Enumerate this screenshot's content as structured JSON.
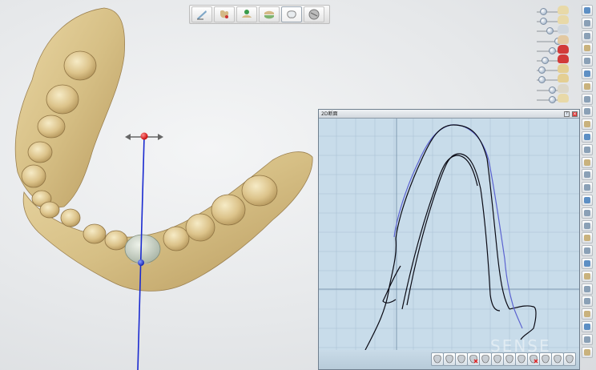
{
  "top_toolbar": {
    "tools": [
      {
        "icon": "scalpel-icon"
      },
      {
        "icon": "tooth-tools-icon"
      },
      {
        "icon": "jaw-upload-icon"
      },
      {
        "icon": "bite-alignment-icon"
      },
      {
        "icon": "crown-icon",
        "active": true
      },
      {
        "icon": "texture-sphere-icon"
      }
    ]
  },
  "right_panel": {
    "opacity_sliders": [
      {
        "swatch_color": "#e8d9a8",
        "level": 0.2
      },
      {
        "swatch_color": "#e8d9a8",
        "level": 0.2
      },
      {
        "swatch_color": "#cfd6dd",
        "level": 0.5
      },
      {
        "swatch_color": "#e3c9a2",
        "level": 0.85
      },
      {
        "swatch_color": "#d23a3a",
        "level": 0.6
      },
      {
        "swatch_color": "#d23a3a",
        "level": 0.3
      },
      {
        "swatch_color": "#e4cf93",
        "level": 0.15
      },
      {
        "swatch_color": "#e4cf93",
        "level": 0.15
      },
      {
        "swatch_color": "#dcd7c8",
        "level": 0.6
      },
      {
        "swatch_color": "#e8d9a8",
        "level": 0.6
      }
    ],
    "buttons": [
      "zoom-fit-icon",
      "expand-icon",
      "move-icon",
      "cap-icon",
      "layers-icon",
      "copy-icon",
      "copy-icon",
      "copy-icon",
      "copy-icon",
      "tooth-icon",
      "tooth-icon",
      "tooth-icon",
      "search-tooth-icon",
      "crown-icon",
      "tooth-icon",
      "tooth-icon",
      "tooth-icon",
      "warning-icon",
      "image-icon",
      "photo-icon",
      "camera-icon",
      "tooth-icon",
      "align-icon",
      "bite-icon",
      "tooth-icon",
      "color-wheel-icon",
      "tooth-icon",
      "tooth-icon"
    ]
  },
  "section_window": {
    "title": "2D断面",
    "help_label": "?",
    "close_label": "×",
    "bottom_tools": [
      "eraser-icon",
      "tooth-section-icon",
      "tooth-section-icon",
      "delete-section-icon",
      "tooth-section-icon",
      "tooth-section-icon",
      "tooth-section-icon",
      "tooth-section-icon",
      "delete-section-icon",
      "tooth-section-icon",
      "measure-icon",
      "tooth-section-icon"
    ]
  },
  "watermark": "SENSE"
}
